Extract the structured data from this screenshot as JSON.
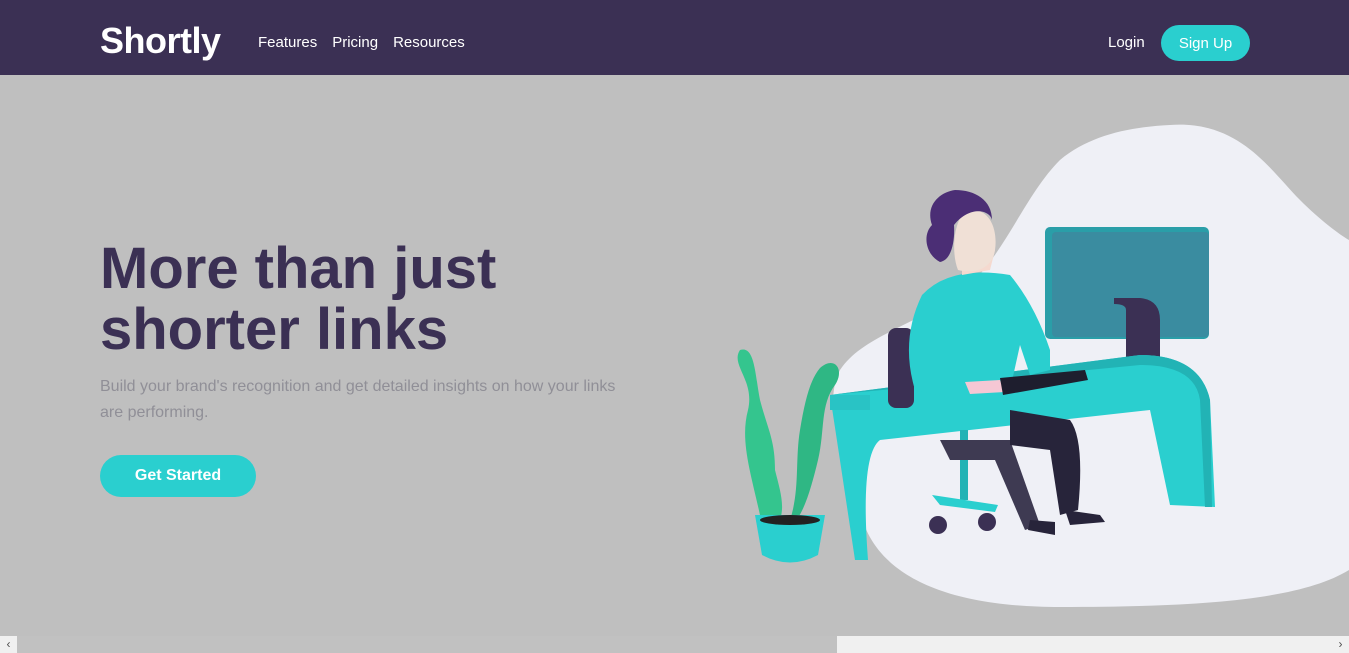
{
  "brand": {
    "logo_text": "Shortly"
  },
  "nav": {
    "links": [
      "Features",
      "Pricing",
      "Resources"
    ],
    "login_label": "Login",
    "signup_label": "Sign Up"
  },
  "hero": {
    "title_line1": "More than just",
    "title_line2": "shorter links",
    "subtitle": "Build your brand's recognition and get detailed insights on how your links are performing.",
    "cta_label": "Get Started"
  },
  "illustration": {
    "icon": "person-working-at-desk-illustration"
  },
  "scrollbar": {
    "left_arrow": "‹",
    "right_arrow": "›"
  },
  "colors": {
    "nav_bg": "#3b3054",
    "accent": "#2acfcf",
    "heading": "#3b3054",
    "body_text": "#908f97",
    "page_bg": "#bfbfbf"
  }
}
